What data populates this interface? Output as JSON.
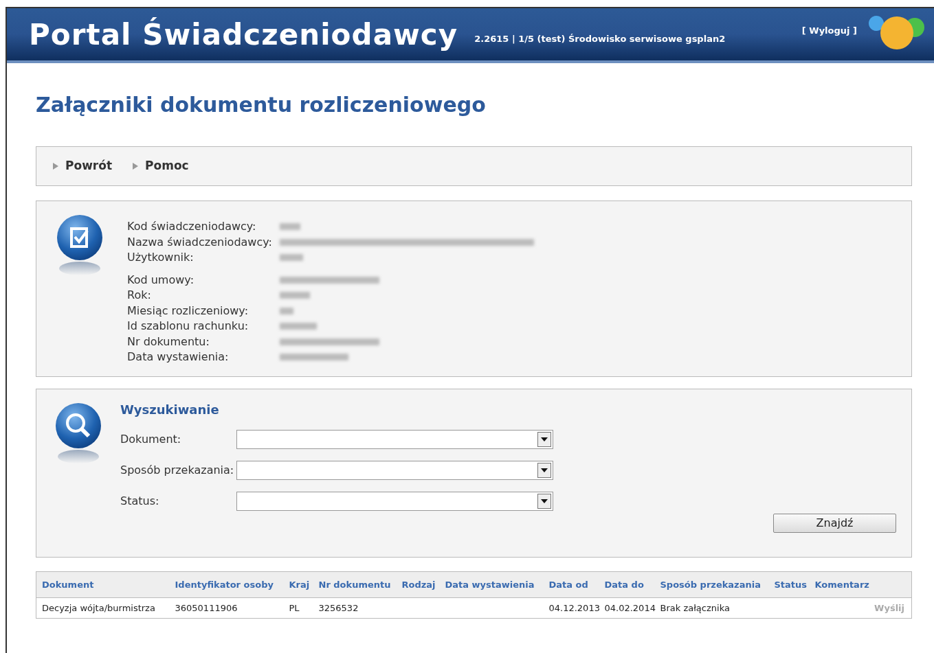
{
  "header": {
    "title": "Portal Świadczeniodawcy",
    "info": "2.2615 | 1/5 (test) Środowisko serwisowe gsplan2",
    "logout": "[ Wyloguj ]"
  },
  "page_title": "Załączniki dokumentu rozliczeniowego",
  "nav": [
    {
      "label": "Powrót"
    },
    {
      "label": "Pomoc"
    }
  ],
  "info_groups": [
    [
      {
        "label": "Kod świadczeniodawcy:",
        "redacted": true
      },
      {
        "label": "Nazwa świadczeniodawcy:",
        "redacted": true
      },
      {
        "label": "Użytkownik:",
        "redacted": true
      }
    ],
    [
      {
        "label": "Kod umowy:",
        "redacted": true
      },
      {
        "label": "Rok:",
        "redacted": true
      },
      {
        "label": "Miesiąc rozliczeniowy:",
        "redacted": true
      },
      {
        "label": "Id szablonu rachunku:",
        "redacted": true
      },
      {
        "label": "Nr dokumentu:",
        "redacted": true
      },
      {
        "label": "Data wystawienia:",
        "redacted": true
      }
    ]
  ],
  "search": {
    "title": "Wyszukiwanie",
    "fields": [
      {
        "label": "Dokument:"
      },
      {
        "label": "Sposób przekazania:"
      },
      {
        "label": "Status:"
      }
    ],
    "button": "Znajdź"
  },
  "table": {
    "columns": [
      "Dokument",
      "Identyfikator osoby",
      "Kraj",
      "Nr dokumentu",
      "Rodzaj",
      "Data wystawienia",
      "Data od",
      "Data do",
      "Sposób przekazania",
      "Status",
      "Komentarz"
    ],
    "rows": [
      {
        "cells": [
          "Decyzja wójta/burmistrza",
          "36050111906",
          "PL",
          "3256532",
          "",
          "",
          "04.12.2013",
          "04.02.2014",
          "Brak załącznika",
          "",
          ""
        ],
        "action": "Wyślij",
        "action_disabled": true
      }
    ]
  }
}
